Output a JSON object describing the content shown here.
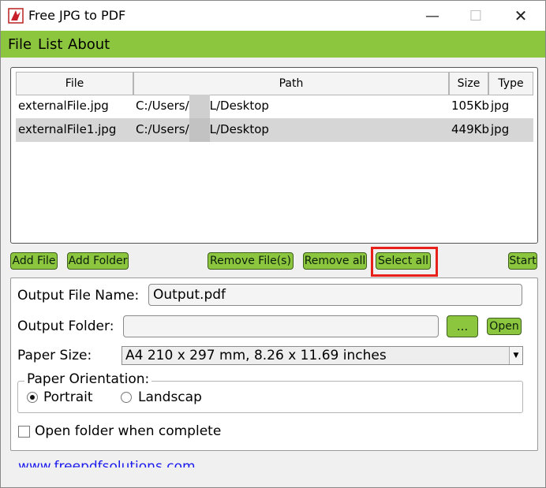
{
  "window": {
    "title": "Free JPG to PDF",
    "minimize": "—",
    "maximize": "☐",
    "close": "✕"
  },
  "menu": {
    "items": [
      "File",
      "List",
      "About"
    ]
  },
  "table": {
    "headers": [
      "File",
      "Path",
      "Size",
      "Type"
    ],
    "rows": [
      {
        "file": "externalFile.jpg",
        "path_start": "C:/Users/",
        "path_end": "L/Desktop",
        "size": "105Kb",
        "type": "jpg"
      },
      {
        "file": "externalFile1.jpg",
        "path_start": "C:/Users/",
        "path_end": "L/Desktop",
        "size": "449Kb",
        "type": "jpg"
      }
    ]
  },
  "buttons": {
    "add_file": "Add File",
    "add_folder": "Add Folder",
    "remove_files": "Remove File(s)",
    "remove_all": "Remove all",
    "select_all": "Select all",
    "start": "Start"
  },
  "options": {
    "output_file_label": "Output File Name:",
    "output_file_value": "Output.pdf",
    "output_folder_label": "Output Folder:",
    "output_folder_value": "",
    "browse_label": "...",
    "open_label": "Open",
    "paper_size_label": "Paper Size:",
    "paper_size_value": "A4 210 x 297 mm, 8.26 x 11.69 inches",
    "orientation_title": "Paper Orientation:",
    "portrait_label": "Portrait",
    "landscape_label": "Landscap",
    "orientation_selected": "portrait",
    "open_folder_label": "Open folder when complete",
    "open_folder_checked": false
  },
  "footer": {
    "link": "www.freepdfsolutions.com"
  },
  "colors": {
    "accent": "#8cc63f",
    "highlight": "#e8201a",
    "link": "#1a1aee",
    "selected_row": "#d6d6d6"
  }
}
